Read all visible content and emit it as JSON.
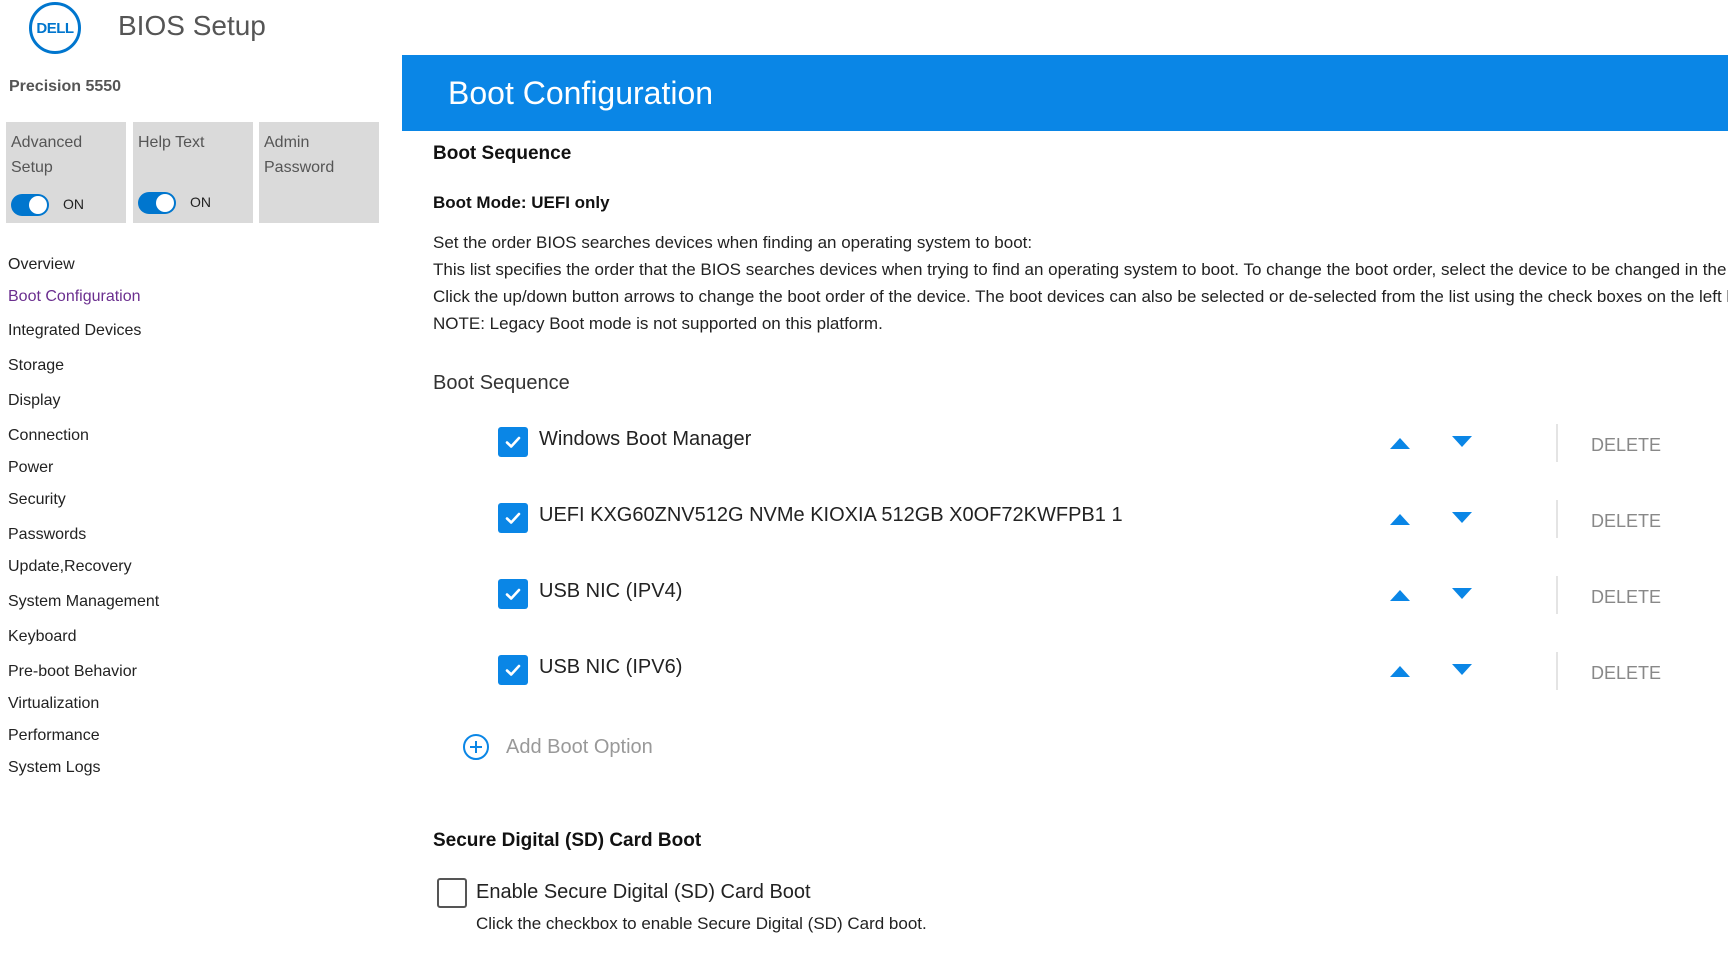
{
  "app": {
    "logo_text": "DELL",
    "title": "BIOS Setup",
    "model": "Precision 5550"
  },
  "tiles": [
    {
      "label": "Advanced\nSetup",
      "toggle": "ON"
    },
    {
      "label": "Help Text",
      "toggle": "ON"
    },
    {
      "label": "Admin\nPassword"
    }
  ],
  "nav": {
    "active": "Boot Configuration",
    "items": [
      "Overview",
      "Boot Configuration",
      "Integrated Devices",
      "Storage",
      "Display",
      "Connection",
      "Power",
      "Security",
      "Passwords",
      "Update,Recovery",
      "System Management",
      "Keyboard",
      "Pre-boot Behavior",
      "Virtualization",
      "Performance",
      "System Logs"
    ]
  },
  "header": {
    "title": "Boot Configuration"
  },
  "boot": {
    "section_title": "Boot Sequence",
    "mode": "Boot Mode: UEFI only",
    "description": [
      "Set the order BIOS searches devices when finding an operating system to boot:",
      "This list specifies the order that the BIOS searches devices when trying to find an operating system to boot.  To change the boot order, select the device to be changed in the list on",
      "Click the up/down button arrows to change the boot order of the device.  The boot devices can also be selected or de-selected from the list using the check boxes on the left hand",
      "NOTE: Legacy Boot mode is not supported on this platform."
    ],
    "list_title": "Boot Sequence",
    "devices": [
      {
        "label": "Windows Boot Manager",
        "checked": true
      },
      {
        "label": "UEFI KXG60ZNV512G NVMe KIOXIA 512GB X0OF72KWFPB1 1",
        "checked": true
      },
      {
        "label": "USB NIC (IPV4)",
        "checked": true
      },
      {
        "label": "USB NIC (IPV6)",
        "checked": true
      }
    ],
    "delete_label": "DELETE",
    "add_label": "Add Boot Option"
  },
  "sd": {
    "title": "Secure Digital (SD) Card Boot",
    "checkbox_label": "Enable Secure Digital (SD) Card Boot",
    "help": "Click the checkbox to enable Secure Digital (SD) Card boot.",
    "checked": false
  },
  "colors": {
    "accent": "#0a86e6",
    "active_nav": "#6b2f8f",
    "tile_bg": "#dadada"
  }
}
